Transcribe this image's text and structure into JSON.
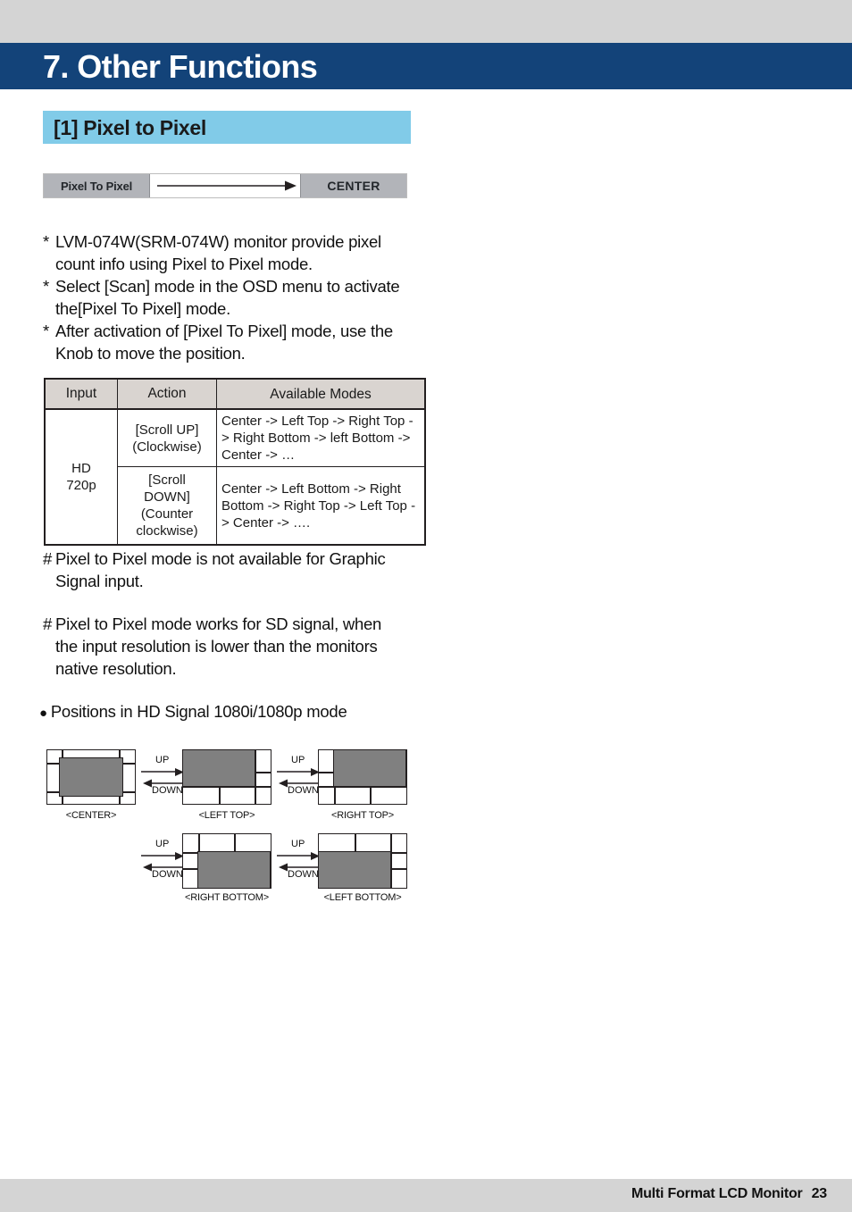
{
  "header": {
    "chapter_title": "7. Other Functions",
    "chapter_bar_color": "#134379",
    "top_strip_color": "#d4d4d4"
  },
  "section": {
    "title": "[1] Pixel to Pixel",
    "bar_color": "#81cbe8"
  },
  "osd_menu": {
    "label": "Pixel To Pixel",
    "value": "CENTER",
    "arrow_icon": "right-arrow-icon",
    "button_color": "#b2b4b9"
  },
  "notes_top": [
    {
      "mark": "*",
      "lines": [
        "LVM-074W(SRM-074W) monitor provide pixel",
        "count info using Pixel to Pixel mode."
      ]
    },
    {
      "mark": "*",
      "lines": [
        "Select  [Scan] mode in the OSD menu to activate",
        "the[Pixel To Pixel] mode."
      ]
    },
    {
      "mark": "*",
      "lines": [
        "After activation of [Pixel To Pixel] mode, use the",
        "Knob to move the position."
      ]
    }
  ],
  "table": {
    "headers": [
      "Input",
      "Action",
      "Available Modes"
    ],
    "rows": [
      {
        "input": "HD\n720p",
        "action": "[Scroll UP]\n(Clockwise)",
        "modes": "Center -> Left Top -> Right Top -> Right Bottom -> left Bottom -> Center -> …"
      },
      {
        "action": "[Scroll\nDOWN]\n(Counter\nclockwise)",
        "modes": "Center -> Left Bottom -> Right Bottom ->  Right Top -> Left Top -> Center -> …."
      }
    ],
    "header_bg": "#d9d4d0"
  },
  "notes_bottom": [
    {
      "mark": "#",
      "lines": [
        "Pixel to Pixel mode is not available for Graphic",
        "Signal input."
      ]
    },
    {
      "mark": "#",
      "lines": [
        "Pixel to Pixel mode works for SD signal, when",
        "the input resolution is lower than the monitors",
        "native resolution."
      ]
    }
  ],
  "positions": {
    "title": "Positions in HD Signal 1080i/1080p mode",
    "bullet": "●",
    "arrow_up_label": "UP",
    "arrow_down_label": "DOWN",
    "diagrams": [
      {
        "caption": "<CENTER>"
      },
      {
        "caption": "<LEFT TOP>"
      },
      {
        "caption": "<RIGHT TOP>"
      },
      {
        "caption": "<RIGHT BOTTOM>"
      },
      {
        "caption": "<LEFT BOTTOM>"
      }
    ]
  },
  "footer": {
    "text": "Multi Format LCD Monitor",
    "page": "23",
    "bar_color": "#d4d4d4"
  }
}
